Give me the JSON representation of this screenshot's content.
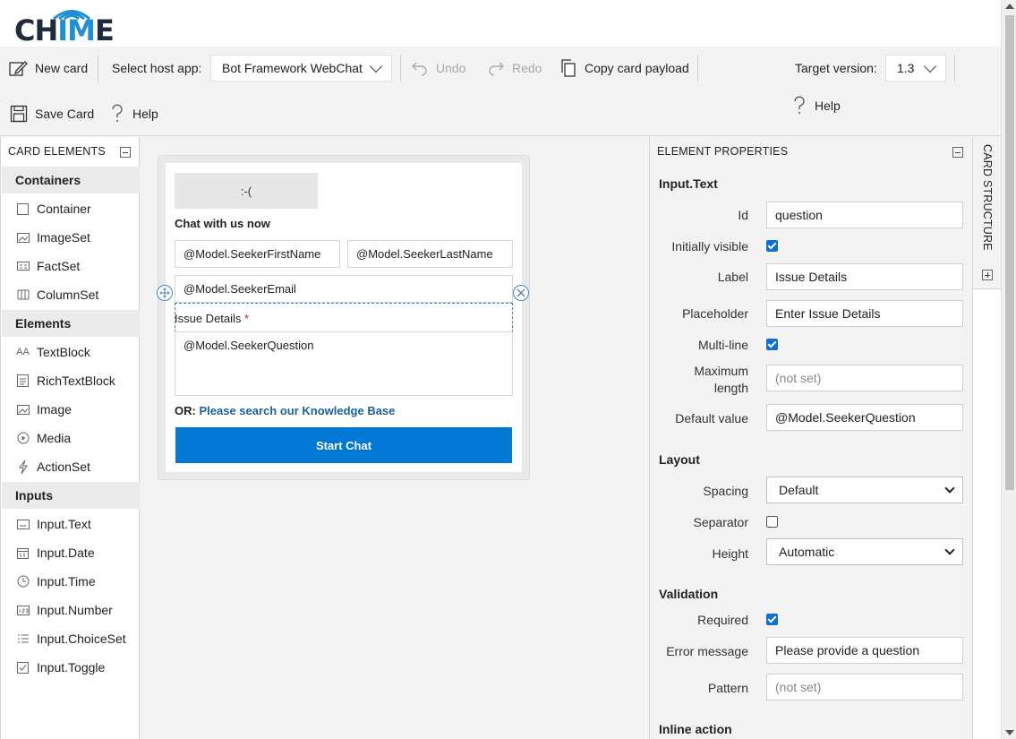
{
  "app": {
    "logo_text_left": "CH",
    "logo_text_hi": "IM",
    "logo_text_right": "E"
  },
  "toolbar": {
    "new_card": "New card",
    "select_host_label": "Select host app:",
    "host_value": "Bot Framework WebChat",
    "undo": "Undo",
    "redo": "Redo",
    "copy_payload": "Copy card payload",
    "target_version_label": "Target version:",
    "target_version_value": "1.3",
    "help": "Help",
    "save_card": "Save Card",
    "help2": "Help"
  },
  "left_panel": {
    "title": "CARD ELEMENTS",
    "groups": {
      "containers": "Containers",
      "elements": "Elements",
      "inputs": "Inputs"
    },
    "items": {
      "container": "Container",
      "imageset": "ImageSet",
      "factset": "FactSet",
      "columnset": "ColumnSet",
      "textblock": "TextBlock",
      "richtextblock": "RichTextBlock",
      "image": "Image",
      "media": "Media",
      "actionset": "ActionSet",
      "input_text": "Input.Text",
      "input_date": "Input.Date",
      "input_time": "Input.Time",
      "input_number": "Input.Number",
      "input_choiceset": "Input.ChoiceSet",
      "input_toggle": "Input.Toggle"
    }
  },
  "card": {
    "image_placeholder": ":-(",
    "title": "Chat with us now",
    "first_name": "@Model.SeekerFirstName",
    "last_name": "@Model.SeekerLastName",
    "email": "@Model.SeekerEmail",
    "issue_label": "Issue Details",
    "required_marker": "*",
    "question": "@Model.SeekerQuestion",
    "or_prefix": "OR:",
    "or_link": "Please search our Knowledge Base",
    "start_button": "Start Chat"
  },
  "properties": {
    "title": "ELEMENT PROPERTIES",
    "element_type": "Input.Text",
    "id_label": "Id",
    "id_value": "question",
    "visible_label": "Initially visible",
    "visible_checked": true,
    "label_label": "Label",
    "label_value": "Issue Details",
    "placeholder_label": "Placeholder",
    "placeholder_value": "Enter Issue Details",
    "multiline_label": "Multi-line",
    "multiline_checked": true,
    "maxlen_label_1": "Maximum",
    "maxlen_label_2": "length",
    "maxlen_placeholder": "(not set)",
    "default_label": "Default value",
    "default_value": "@Model.SeekerQuestion",
    "layout_head": "Layout",
    "spacing_label": "Spacing",
    "spacing_value": "Default",
    "separator_label": "Separator",
    "separator_checked": false,
    "height_label": "Height",
    "height_value": "Automatic",
    "validation_head": "Validation",
    "required_label": "Required",
    "required_checked": true,
    "error_label": "Error message",
    "error_value": "Please provide a question",
    "pattern_label": "Pattern",
    "pattern_placeholder": "(not set)",
    "inline_head": "Inline action"
  },
  "structure": {
    "title": "CARD STRUCTURE"
  },
  "colors": {
    "accent": "#0078d4",
    "brand_blue": "#1f8fd6",
    "link": "#1d5f9e",
    "checkbox": "#0b6fd8"
  },
  "icons": {
    "new_card": "edit-icon",
    "undo": "undo-icon",
    "redo": "redo-icon",
    "copy": "copy-icon",
    "save": "save-icon",
    "help": "question-icon",
    "move": "move-handle-icon",
    "remove": "remove-circle-icon"
  }
}
